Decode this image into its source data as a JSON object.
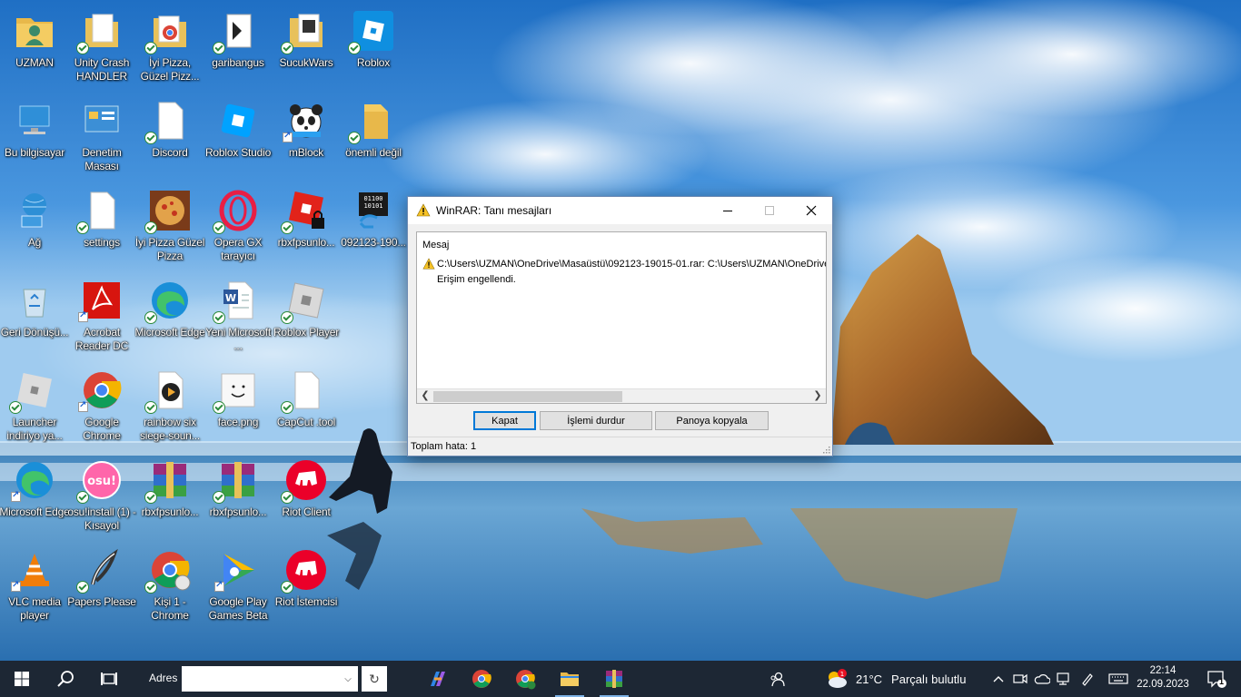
{
  "desktop": {
    "icons": [
      {
        "label": "UZMAN"
      },
      {
        "label": "Unity Crash HANDLER"
      },
      {
        "label": "İyi Pizza, Güzel Pizz..."
      },
      {
        "label": "garibangus"
      },
      {
        "label": "SucukWars"
      },
      {
        "label": "Roblox"
      },
      {
        "label": "Bu bilgisayar"
      },
      {
        "label": "Denetim Masası"
      },
      {
        "label": "Discord"
      },
      {
        "label": "Roblox Studio"
      },
      {
        "label": "mBlock"
      },
      {
        "label": "önemli değil"
      },
      {
        "label": "Ağ"
      },
      {
        "label": "settings"
      },
      {
        "label": "İyi Pizza Güzel Pizza"
      },
      {
        "label": "Opera GX tarayıcı"
      },
      {
        "label": "rbxfpsunlo..."
      },
      {
        "label": "092123-190..."
      },
      {
        "label": "Geri Dönüşü..."
      },
      {
        "label": "Acrobat Reader DC"
      },
      {
        "label": "Microsoft Edge"
      },
      {
        "label": "Yeni Microsoft ..."
      },
      {
        "label": "Roblox Player"
      },
      {
        "label": "Launcher indiriyo ya..."
      },
      {
        "label": "Google Chrome"
      },
      {
        "label": "rainbow six siege-soun..."
      },
      {
        "label": "face.png"
      },
      {
        "label": "CapCut .tool"
      },
      {
        "label": "Microsoft Edge"
      },
      {
        "label": "osu!install (1) - Kısayol"
      },
      {
        "label": "rbxfpsunlo..."
      },
      {
        "label": "rbxfpsunlo..."
      },
      {
        "label": "Riot Client"
      },
      {
        "label": "VLC media player"
      },
      {
        "label": "Papers Please"
      },
      {
        "label": "Kişi 1 - Chrome"
      },
      {
        "label": "Google Play Games Beta"
      },
      {
        "label": "Riot İstemcisi"
      }
    ]
  },
  "dialog": {
    "title": "WinRAR: Tanı mesajları",
    "header": "Mesaj",
    "message_path": "C:\\Users\\UZMAN\\OneDrive\\Masaüstü\\092123-19015-01.rar: C:\\Users\\UZMAN\\OneDrive\\",
    "message_error": "Erişim engellendi.",
    "buttons": {
      "close": "Kapat",
      "stop": "İşlemi durdur",
      "copy": "Panoya kopyala"
    },
    "status": "Toplam hata: 1"
  },
  "taskbar": {
    "address_label": "Adres",
    "address_value": "",
    "weather_temp": "21°C",
    "weather_desc": "Parçalı bulutlu",
    "time": "22:14",
    "date": "22.09.2023",
    "notification_count": "1"
  },
  "colors": {
    "taskbar": "#1d2734",
    "dialog_bg": "#f0f0f0",
    "accent": "#0078d7"
  }
}
